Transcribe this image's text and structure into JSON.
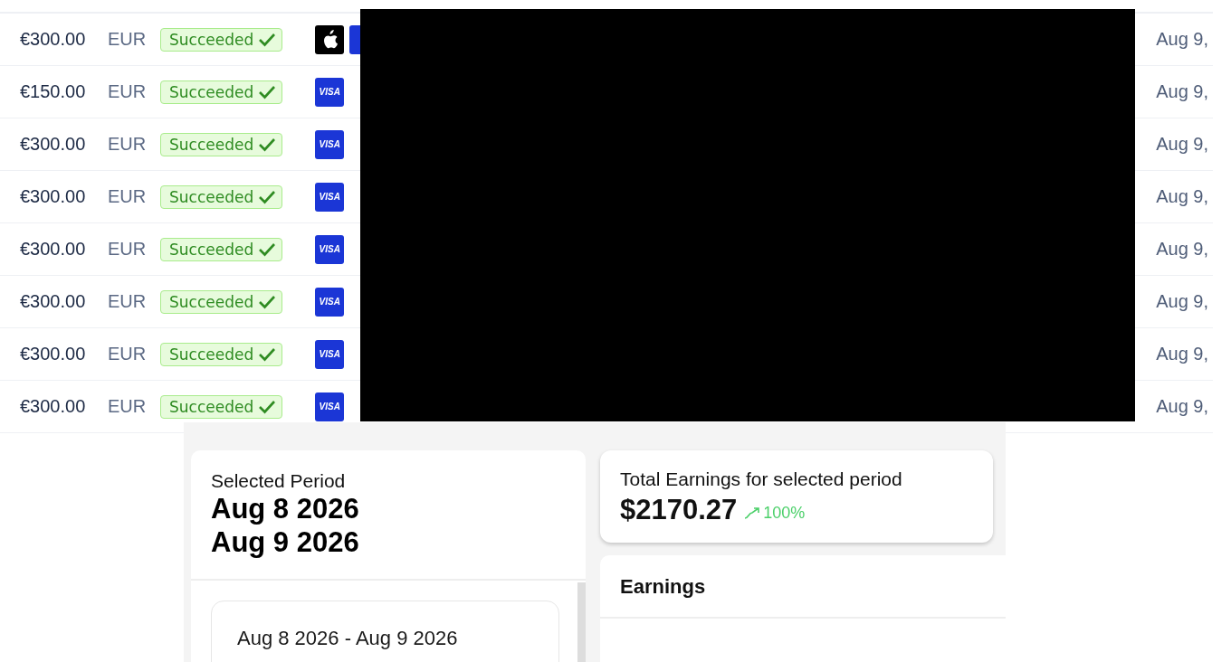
{
  "transactions": [
    {
      "amount": "€300.00",
      "currency": "EUR",
      "status": "Succeeded",
      "payment_icons": [
        {
          "kind": "apple"
        },
        {
          "kind": "visa"
        }
      ],
      "date": "Aug 9,"
    },
    {
      "amount": "€150.00",
      "currency": "EUR",
      "status": "Succeeded",
      "payment_icons": [
        {
          "kind": "visa",
          "label": "VISA"
        }
      ],
      "date": "Aug 9,"
    },
    {
      "amount": "€300.00",
      "currency": "EUR",
      "status": "Succeeded",
      "payment_icons": [
        {
          "kind": "visa",
          "label": "VISA"
        }
      ],
      "date": "Aug 9,"
    },
    {
      "amount": "€300.00",
      "currency": "EUR",
      "status": "Succeeded",
      "payment_icons": [
        {
          "kind": "visa",
          "label": "VISA"
        }
      ],
      "date": "Aug 9,"
    },
    {
      "amount": "€300.00",
      "currency": "EUR",
      "status": "Succeeded",
      "payment_icons": [
        {
          "kind": "visa",
          "label": "VISA"
        }
      ],
      "date": "Aug 9,"
    },
    {
      "amount": "€300.00",
      "currency": "EUR",
      "status": "Succeeded",
      "payment_icons": [
        {
          "kind": "visa",
          "label": "VISA"
        }
      ],
      "date": "Aug 9,"
    },
    {
      "amount": "€300.00",
      "currency": "EUR",
      "status": "Succeeded",
      "payment_icons": [
        {
          "kind": "visa",
          "label": "VISA"
        }
      ],
      "date": "Aug 9,"
    },
    {
      "amount": "€300.00",
      "currency": "EUR",
      "status": "Succeeded",
      "payment_icons": [
        {
          "kind": "visa",
          "label": "VISA"
        }
      ],
      "date": "Aug 9,"
    }
  ],
  "selected_period": {
    "title": "Selected Period",
    "start": "Aug 8 2026",
    "end": "Aug 9 2026",
    "ranges": [
      {
        "label": "Aug 8 2026 - Aug 9 2026"
      }
    ]
  },
  "total_earnings": {
    "label": "Total Earnings for selected period",
    "value": "$2170.27",
    "rising": true,
    "change": "100%"
  },
  "earnings": {
    "title": "Earnings"
  }
}
